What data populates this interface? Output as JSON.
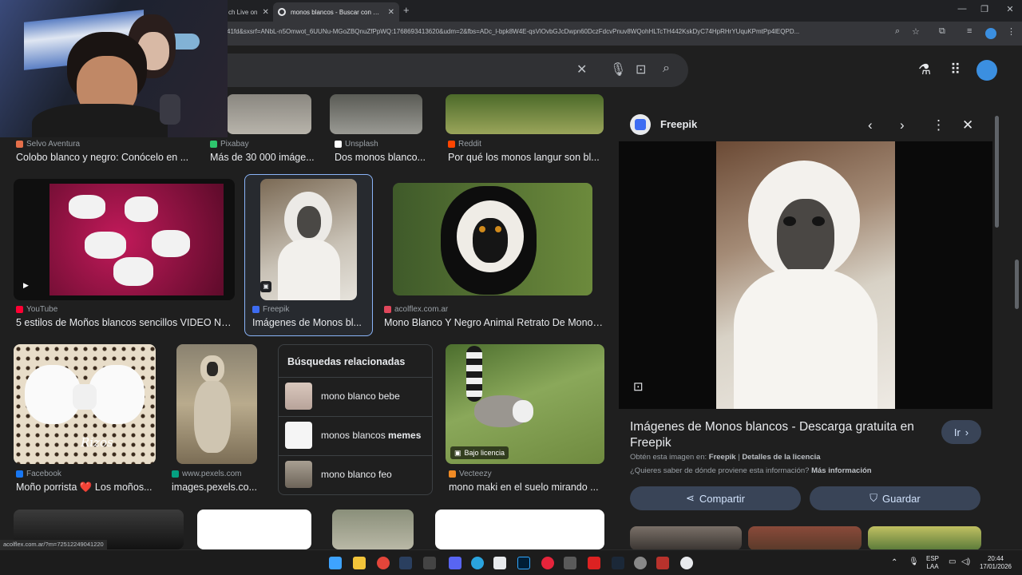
{
  "browser": {
    "tabs": [
      {
        "label": "ch Live on",
        "active": false
      },
      {
        "label": "monos blancos - Buscar con Google",
        "active": true
      }
    ],
    "new_tab": "+",
    "url": "41fd&sxsrf=ANbL-n5Omwot_6UUNu-MGoZBQnuZfPpWQ:1768693413620&udm=2&fbs=ADc_l-bpk8W4E-qsVlOvbGJcDwpn60DczFdcvPnuv8WQohHLTcTH442KskDyC74HpRHrYUquKPmtPp4lEQPD...",
    "status_link": "acolflex.com.ar/?m=72512249041220"
  },
  "results": {
    "row1": [
      {
        "source": "Selvo Aventura",
        "title": "Colobo blanco y negro: Conócelo en ...",
        "fav_color": "#e46f4a"
      },
      {
        "source": "Pixabay",
        "title": "Más de 30 000 imáge...",
        "fav_color": "#2ec66d"
      },
      {
        "source": "Unsplash",
        "title": "Dos monos blanco...",
        "fav_color": "#ffffff"
      },
      {
        "source": "Reddit",
        "title": "Por qué los monos langur son bl...",
        "fav_color": "#ff4500"
      }
    ],
    "row2": [
      {
        "source": "YouTube",
        "title": "5 estilos de Moños blancos sencillos VIDEO No...",
        "fav_color": "#ff0033"
      },
      {
        "source": "Freepik",
        "title": "Imágenes de Monos bl...",
        "fav_color": "#3d6cf2"
      },
      {
        "source": "acolflex.com.ar",
        "title": "Mono Blanco Y Negro Animal Retrato De Mono ...",
        "fav_color": "#e0475b"
      }
    ],
    "row3": [
      {
        "source": "Facebook",
        "title": "Moño porrista ❤️ Los moños...",
        "fav_color": "#1877f2"
      },
      {
        "source": "www.pexels.com",
        "title": "images.pexels.co...",
        "fav_color": "#05a081"
      },
      {
        "source": "Vecteezy",
        "title": "mono maki en el suelo mirando ...",
        "fav_color": "#f08a24"
      }
    ],
    "licensed_badge": "Bajo licencia",
    "bow_watermark": "Rizos"
  },
  "related": {
    "heading": "Búsquedas relacionadas",
    "items": [
      {
        "plain": "mono blanco bebe",
        "bold": ""
      },
      {
        "plain": "monos blancos ",
        "bold": "memes"
      },
      {
        "plain": "mono blanco feo",
        "bold": ""
      }
    ]
  },
  "panel": {
    "site_name": "Freepik",
    "title": "Imágenes de Monos blancos - Descarga gratuita en Freepik",
    "go_label": "Ir",
    "obtain_prefix": "Obtén esta imagen en:",
    "obtain_site": "Freepik",
    "separator": "|",
    "license_details": "Detalles de la licencia",
    "question": "¿Quieres saber de dónde proviene esta información?",
    "more_info": "Más información",
    "share_label": "Compartir",
    "save_label": "Guardar"
  },
  "taskbar": {
    "lang_top": "ESP",
    "lang_bottom": "LAA",
    "time": "20:44",
    "date": "17/01/2026"
  },
  "colors": {
    "accent": "#8ab4f8",
    "pill_bg": "#394457",
    "page_bg": "#1f1f1f"
  }
}
